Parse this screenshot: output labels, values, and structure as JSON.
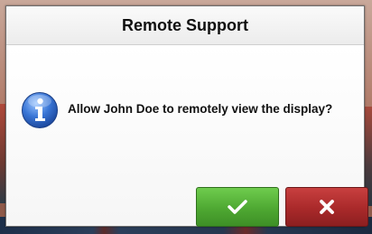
{
  "dialog": {
    "title": "Remote Support",
    "message": "Allow John Doe to remotely view the display?",
    "icon": "info-icon",
    "buttons": {
      "accept": {
        "icon": "checkmark-icon",
        "color": "#4ea832"
      },
      "reject": {
        "icon": "close-icon",
        "color": "#a9292a"
      }
    }
  }
}
